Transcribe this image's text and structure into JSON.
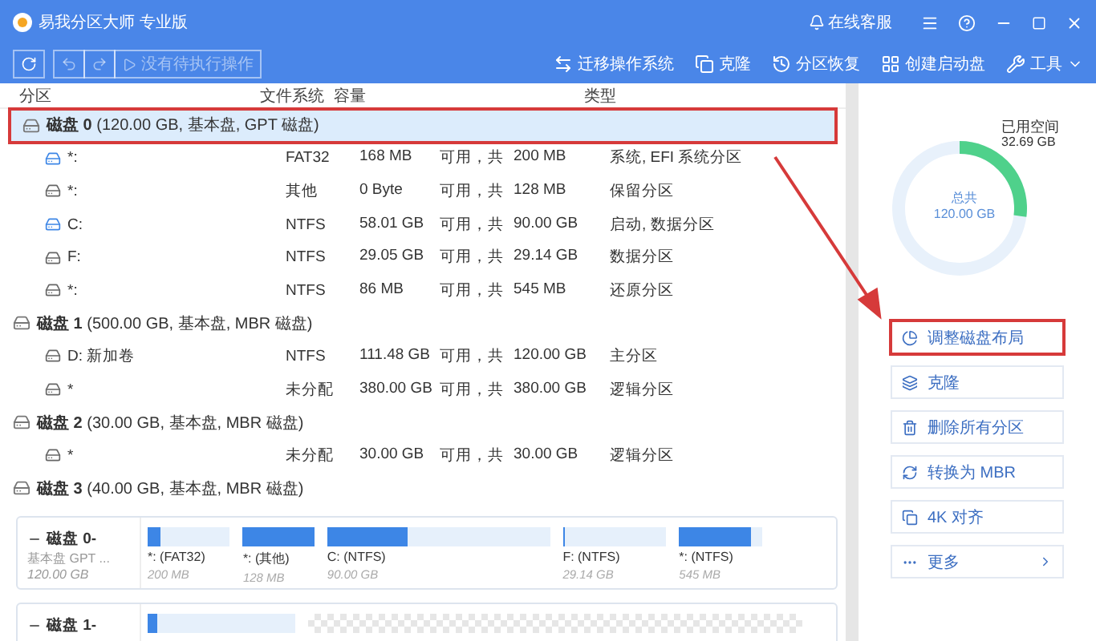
{
  "window": {
    "title": "易我分区大师 专业版",
    "support": "在线客服"
  },
  "toolbar": {
    "pending": "没有待执行操作",
    "actions": [
      {
        "kind": "migrate",
        "label": "迁移操作系统"
      },
      {
        "kind": "clone",
        "label": "克隆"
      },
      {
        "kind": "recover",
        "label": "分区恢复"
      },
      {
        "kind": "boot",
        "label": "创建启动盘"
      },
      {
        "kind": "tools",
        "label": "工具"
      }
    ]
  },
  "table": {
    "columns": [
      "分区",
      "文件系统",
      "容量",
      "类型"
    ],
    "disks": [
      {
        "name": "磁盘 0",
        "info": "(120.00 GB, 基本盘, GPT 磁盘)",
        "selected": true,
        "partitions": [
          {
            "kind": "system",
            "name": "*:",
            "fs": "FAT32",
            "free": "168 MB",
            "of": "可用，共",
            "total": "200 MB",
            "type": "系统, EFI 系统分区"
          },
          {
            "kind": "plain",
            "name": "*:",
            "fs": "其他",
            "free": "0 Byte",
            "of": "可用，共",
            "total": "128 MB",
            "type": "保留分区"
          },
          {
            "kind": "system",
            "name": "C:",
            "fs": "NTFS",
            "free": "58.01 GB",
            "of": "可用，共",
            "total": "90.00 GB",
            "type": "启动, 数据分区"
          },
          {
            "kind": "plain",
            "name": "F:",
            "fs": "NTFS",
            "free": "29.05 GB",
            "of": "可用，共",
            "total": "29.14 GB",
            "type": "数据分区"
          },
          {
            "kind": "plain",
            "name": "*:",
            "fs": "NTFS",
            "free": "86 MB",
            "of": "可用，共",
            "total": "545 MB",
            "type": "还原分区"
          }
        ]
      },
      {
        "name": "磁盘 1",
        "info": "(500.00 GB, 基本盘, MBR 磁盘)",
        "selected": false,
        "partitions": [
          {
            "kind": "plain",
            "name": "D: 新加卷",
            "fs": "NTFS",
            "free": "111.48 GB",
            "of": "可用，共",
            "total": "120.00 GB",
            "type": "主分区"
          },
          {
            "kind": "plain",
            "name": "*",
            "fs": "未分配",
            "free": "380.00 GB",
            "of": "可用，共",
            "total": "380.00 GB",
            "type": "逻辑分区"
          }
        ]
      },
      {
        "name": "磁盘 2",
        "info": "(30.00 GB, 基本盘, MBR 磁盘)",
        "selected": false,
        "partitions": [
          {
            "kind": "plain",
            "name": "*",
            "fs": "未分配",
            "free": "30.00 GB",
            "of": "可用，共",
            "total": "30.00 GB",
            "type": "逻辑分区"
          }
        ]
      },
      {
        "name": "磁盘 3",
        "info": "(40.00 GB, 基本盘, MBR 磁盘)",
        "selected": false
      }
    ]
  },
  "disk_map": [
    {
      "name": "磁盘 0-",
      "style": "基本盘 GPT ...",
      "size": "120.00 GB",
      "segments": [
        {
          "kind": "used",
          "label": "*: (FAT32)",
          "size": "200 MB",
          "level": 0.16
        },
        {
          "kind": "used",
          "label": "*: (其他)",
          "size": "128 MB",
          "level": 1
        },
        {
          "kind": "used",
          "label": "C: (NTFS)",
          "size": "90.00 GB",
          "level": 0.36
        },
        {
          "kind": "used",
          "label": "F: (NTFS)",
          "size": "29.14 GB",
          "level": 0.02
        },
        {
          "kind": "used",
          "label": "*: (NTFS)",
          "size": "545 MB",
          "level": 0.86
        }
      ]
    },
    {
      "name": "磁盘 1-",
      "segments": [
        {
          "kind": "used",
          "level": 0.07
        },
        {
          "kind": "unallocated"
        }
      ]
    }
  ],
  "usage": {
    "used_label": "已用空间",
    "used": "32.69 GB",
    "total_label": "总共",
    "total": "120.00 GB",
    "level": 0.27
  },
  "actions": [
    {
      "kind": "resize",
      "label": "调整磁盘布局",
      "highlighted": true
    },
    {
      "kind": "clone",
      "label": "克隆",
      "highlighted": false
    },
    {
      "kind": "delete",
      "label": "删除所有分区",
      "highlighted": false
    },
    {
      "kind": "convert",
      "label": "转换为 MBR",
      "highlighted": false
    },
    {
      "kind": "align",
      "label": "4K 对齐",
      "highlighted": false
    },
    {
      "kind": "more",
      "label": "更多",
      "highlighted": false
    }
  ]
}
